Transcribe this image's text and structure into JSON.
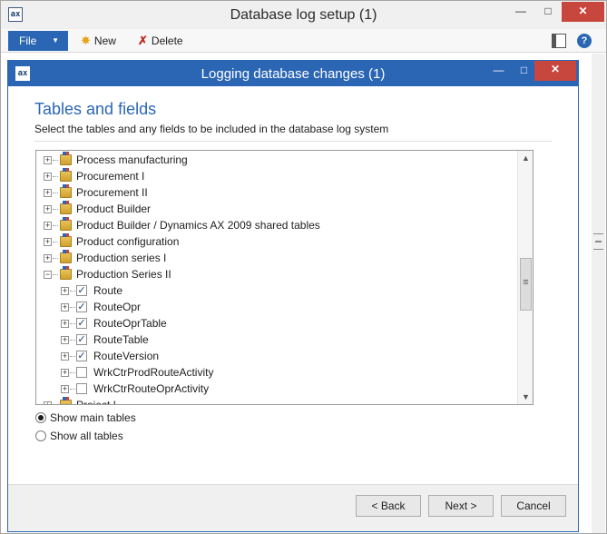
{
  "outer_window": {
    "title": "Database log setup (1)",
    "app_icon": "ax",
    "minimize": "—",
    "maximize": "□",
    "close": "✕"
  },
  "toolbar": {
    "file_label": "File",
    "new_label": "New",
    "delete_label": "Delete",
    "help_label": "?"
  },
  "dialog": {
    "title": "Logging database changes (1)",
    "heading": "Tables and fields",
    "subheading": "Select the tables and any fields to be included in the database log system",
    "minimize": "—",
    "maximize": "□",
    "close": "✕"
  },
  "tree": {
    "nodes": [
      {
        "label": "Process manufacturing",
        "expander": "+"
      },
      {
        "label": "Procurement I",
        "expander": "+"
      },
      {
        "label": "Procurement II",
        "expander": "+"
      },
      {
        "label": "Product Builder",
        "expander": "+"
      },
      {
        "label": "Product Builder / Dynamics AX 2009 shared tables",
        "expander": "+"
      },
      {
        "label": "Product configuration",
        "expander": "+"
      },
      {
        "label": "Production series I",
        "expander": "+"
      },
      {
        "label": "Production Series II",
        "expander": "−"
      },
      {
        "label": "Route",
        "expander": "+",
        "checked": true
      },
      {
        "label": "RouteOpr",
        "expander": "+",
        "checked": true
      },
      {
        "label": "RouteOprTable",
        "expander": "+",
        "checked": true
      },
      {
        "label": "RouteTable",
        "expander": "+",
        "checked": true
      },
      {
        "label": "RouteVersion",
        "expander": "+",
        "checked": true
      },
      {
        "label": "WrkCtrProdRouteActivity",
        "expander": "+",
        "checked": false
      },
      {
        "label": "WrkCtrRouteOprActivity",
        "expander": "+",
        "checked": false
      },
      {
        "label": "Project I",
        "expander": "+"
      }
    ],
    "check_mark": "✓",
    "scroll_up": "▲",
    "scroll_down": "▼"
  },
  "options": {
    "show_main_tables": "Show main tables",
    "show_all_tables": "Show all tables",
    "selected": "show_main_tables"
  },
  "buttons": {
    "back": "< Back",
    "next": "Next >",
    "cancel": "Cancel"
  },
  "colors": {
    "accent": "#2b66b5",
    "close_red": "#c7463d"
  }
}
